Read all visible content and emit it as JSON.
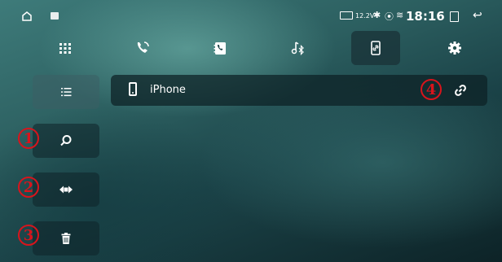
{
  "status_bar": {
    "battery_voltage": "12.2V",
    "time": "18:16",
    "icons": [
      "home-icon",
      "notification-icon",
      "battery-icon",
      "bluetooth-icon",
      "location-icon",
      "wifi-icon",
      "recent-apps-icon",
      "back-icon"
    ]
  },
  "tabs": [
    {
      "icon": "keypad-icon",
      "active": false
    },
    {
      "icon": "call-log-icon",
      "active": false
    },
    {
      "icon": "contacts-icon",
      "active": false
    },
    {
      "icon": "bluetooth-music-icon",
      "active": false
    },
    {
      "icon": "device-link-icon",
      "active": true
    },
    {
      "icon": "settings-icon",
      "active": false
    }
  ],
  "side_buttons": [
    {
      "icon": "list-icon"
    },
    {
      "icon": "search-icon"
    },
    {
      "icon": "pair-icon"
    },
    {
      "icon": "trash-icon"
    }
  ],
  "device_list": {
    "items": [
      {
        "name": "iPhone",
        "icon": "phone-icon",
        "action_icon": "link-icon"
      }
    ]
  },
  "annotations": {
    "marker_1": "1",
    "marker_2": "2",
    "marker_3": "3",
    "marker_4": "4",
    "color": "#d8141c"
  },
  "colors": {
    "accent_red": "#d8141c",
    "background_teal": "#2c5f60",
    "panel_dark": "#0c2024"
  }
}
